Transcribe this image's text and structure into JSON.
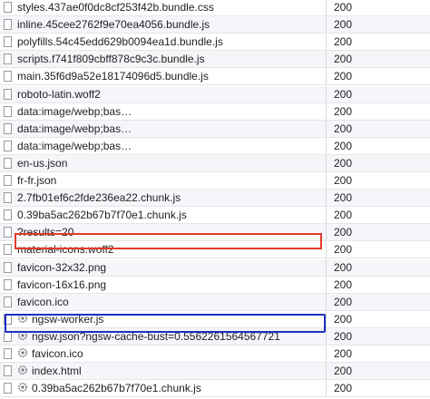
{
  "requests": [
    {
      "name": "styles.437ae0f0dc8cf253f42b.bundle.css",
      "status": "200",
      "sw": false
    },
    {
      "name": "inline.45cee2762f9e70ea4056.bundle.js",
      "status": "200",
      "sw": false
    },
    {
      "name": "polyfills.54c45edd629b0094ea1d.bundle.js",
      "status": "200",
      "sw": false
    },
    {
      "name": "scripts.f741f809cbff878c9c3c.bundle.js",
      "status": "200",
      "sw": false
    },
    {
      "name": "main.35f6d9a52e18174096d5.bundle.js",
      "status": "200",
      "sw": false
    },
    {
      "name": "roboto-latin.woff2",
      "status": "200",
      "sw": false
    },
    {
      "name": "data:image/webp;bas…",
      "status": "200",
      "sw": false
    },
    {
      "name": "data:image/webp;bas…",
      "status": "200",
      "sw": false
    },
    {
      "name": "data:image/webp;bas…",
      "status": "200",
      "sw": false
    },
    {
      "name": "en-us.json",
      "status": "200",
      "sw": false
    },
    {
      "name": "fr-fr.json",
      "status": "200",
      "sw": false
    },
    {
      "name": "2.7fb01ef6c2fde236ea22.chunk.js",
      "status": "200",
      "sw": false
    },
    {
      "name": "0.39ba5ac262b67b7f70e1.chunk.js",
      "status": "200",
      "sw": false
    },
    {
      "name": "?results=20",
      "status": "200",
      "sw": false
    },
    {
      "name": "material-icons.woff2",
      "status": "200",
      "sw": false
    },
    {
      "name": "favicon-32x32.png",
      "status": "200",
      "sw": false
    },
    {
      "name": "favicon-16x16.png",
      "status": "200",
      "sw": false
    },
    {
      "name": "favicon.ico",
      "status": "200",
      "sw": false
    },
    {
      "name": "ngsw-worker.js",
      "status": "200",
      "sw": true
    },
    {
      "name": "ngsw.json?ngsw-cache-bust=0.5562261564567721",
      "status": "200",
      "sw": true
    },
    {
      "name": "favicon.ico",
      "status": "200",
      "sw": true
    },
    {
      "name": "index.html",
      "status": "200",
      "sw": true
    },
    {
      "name": "0.39ba5ac262b67b7f70e1.chunk.js",
      "status": "200",
      "sw": true
    }
  ],
  "highlights": {
    "red_color": "#e23a2a",
    "blue_color": "#1f2fbf"
  }
}
